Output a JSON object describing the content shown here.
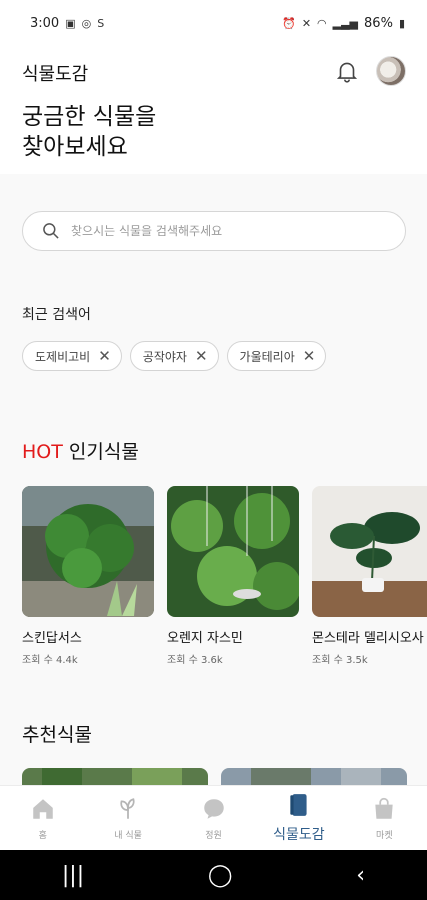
{
  "status_bar": {
    "time": "3:00",
    "battery": "86%"
  },
  "header": {
    "app_title": "식물도감",
    "headline_line1": "궁금한 식물을",
    "headline_line2": "찾아보세요"
  },
  "search": {
    "placeholder": "찾으시는 식물을 검색해주세요"
  },
  "recent": {
    "label": "최근 검색어",
    "chips": [
      "도제비고비",
      "공작야자",
      "가울테리아"
    ]
  },
  "hot": {
    "prefix": "HOT",
    "title": "인기식물",
    "items": [
      {
        "name": "스킨답서스",
        "views": "조회 수 4.4k"
      },
      {
        "name": "오렌지 자스민",
        "views": "조회 수 3.6k"
      },
      {
        "name": "몬스테라 델리시오사",
        "views": "조회 수 3.5k"
      }
    ]
  },
  "recommended": {
    "title": "추천식물"
  },
  "bottom_nav": {
    "items": [
      {
        "label": "홈",
        "icon": "home-icon"
      },
      {
        "label": "내 식물",
        "icon": "leaf-icon"
      },
      {
        "label": "정원",
        "icon": "chat-bubble-icon"
      },
      {
        "label": "식물도감",
        "icon": "book-icon"
      },
      {
        "label": "마켓",
        "icon": "shopping-bag-icon"
      }
    ],
    "active_index": 3
  },
  "colors": {
    "hot_accent": "#e21b1b",
    "active_nav": "#2f5d8a"
  }
}
